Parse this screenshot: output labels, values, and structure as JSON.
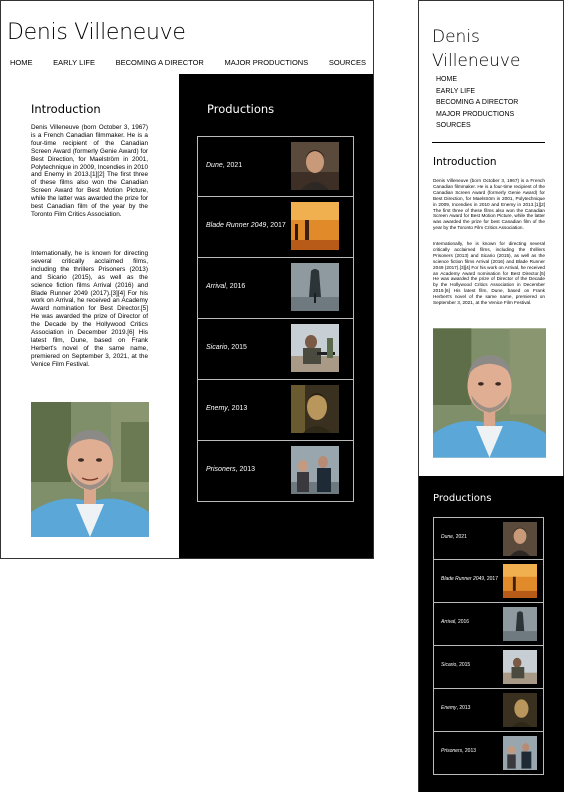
{
  "site": {
    "title": "Denis Villeneuve"
  },
  "nav": [
    "HOME",
    "EARLY LIFE",
    "BECOMING A DIRECTOR",
    "MAJOR PRODUCTIONS",
    "SOURCES"
  ],
  "intro": {
    "heading": "Introduction",
    "paragraph1": "Denis Villeneuve (born October 3, 1967) is a French Canadian filmmaker. He is a four-time recipient of the Canadian Screen Award (formerly Genie Award) for Best Direction, for Maelström in 2001, Polytechnique in 2009, Incendies in 2010 and Enemy in 2013.[1][2] The first three of these films also won the Canadian Screen Award for Best Motion Picture, while the latter was awarded the prize for best Canadian film of the year by the Toronto Film Critics Association.",
    "paragraph2": "Internationally, he is known for directing several critically acclaimed films, including the thrillers Prisoners (2013) and Sicario (2015), as well as the science fiction films Arrival (2016) and Blade Runner 2049 (2017).[3][4] For his work on Arrival, he received an Academy Award nomination for Best Director.[5] He was awarded the prize of Director of the Decade by the Hollywood Critics Association in December 2019.[6] His latest film, Dune, based on Frank Herbert's novel of the same name, premiered on September 3, 2021, at the Venice Film Festival."
  },
  "productions": {
    "heading": "Productions",
    "films": [
      {
        "title": "Dune",
        "year": ", 2021",
        "poster": "dune-poster"
      },
      {
        "title": "Blade Runner 2049",
        "year": ", 2017",
        "poster": "blade-runner-poster"
      },
      {
        "title": "Arrival",
        "year": ", 2016",
        "poster": "arrival-poster"
      },
      {
        "title": "Sicario",
        "year": ", 2015",
        "poster": "sicario-poster"
      },
      {
        "title": "Enemy",
        "year": ", 2013",
        "poster": "enemy-poster"
      },
      {
        "title": "Prisoners",
        "year": ", 2013",
        "poster": "prisoners-poster"
      }
    ]
  },
  "colors": {
    "background": "#ffffff",
    "productions_bg": "#000000",
    "text": "#000000",
    "productions_text": "#ffffff"
  }
}
